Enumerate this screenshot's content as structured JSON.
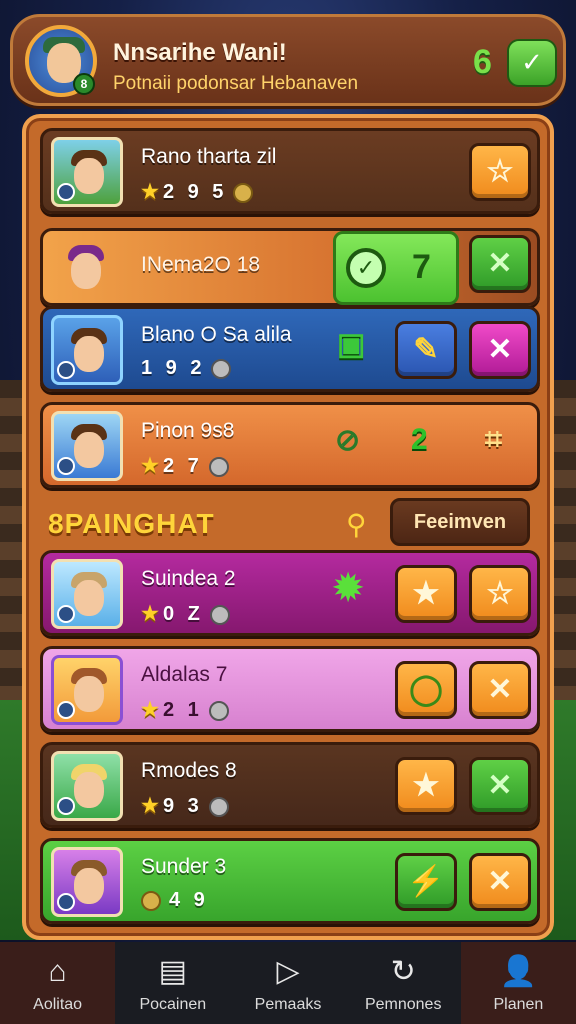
{
  "header": {
    "title": "Nnsarihe Wani!",
    "subtitle": "Potnaii podonsar Hebanaven",
    "count": "6",
    "avatar_badge": "8",
    "action_icon": "check-icon"
  },
  "rows": [
    {
      "name": "Rano tharta zil",
      "stats": "2 9 5",
      "buttons": [
        "star-icon"
      ]
    },
    {
      "name": "INema2O 18",
      "wide_value": "7",
      "buttons": [
        "close-icon"
      ]
    },
    {
      "name": "Blano O Sa alila",
      "stats": "1 9 2",
      "buttons": [
        "edit-icon",
        "close-icon"
      ]
    },
    {
      "name": "Pinon 9s8",
      "stats": "2 7",
      "value": "2"
    },
    {
      "name": "Suindea 2",
      "stats": "0 Z",
      "buttons": [
        "star-icon",
        "star-icon"
      ]
    },
    {
      "name": "Aldalas 7",
      "stats": "2 1",
      "buttons": [
        "chat-icon",
        "close-icon"
      ]
    },
    {
      "name": "Rmodes 8",
      "stats": "9 3",
      "buttons": [
        "star-icon",
        "close-icon"
      ]
    },
    {
      "name": "Sunder 3",
      "stats": "4 9",
      "buttons": [
        "bolt-icon",
        "close-icon"
      ]
    }
  ],
  "section": {
    "title": "8PAINGHAT",
    "button": "Feeimven"
  },
  "nav": [
    {
      "label": "Aolitao",
      "icon": "home-icon"
    },
    {
      "label": "Pocainen",
      "icon": "cards-icon"
    },
    {
      "label": "Pemaaks",
      "icon": "play-icon"
    },
    {
      "label": "Pemnones",
      "icon": "refresh-icon"
    },
    {
      "label": "Planen",
      "icon": "user-icon"
    }
  ]
}
